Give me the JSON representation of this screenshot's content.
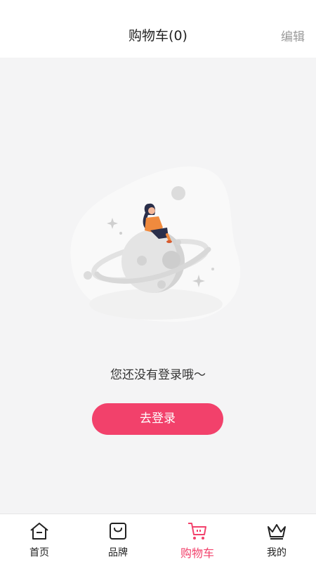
{
  "header": {
    "title": "购物车(0)",
    "edit_label": "编辑"
  },
  "empty_state": {
    "message": "您还没有登录哦～",
    "illustration_icon": "girl-on-planet-illustration"
  },
  "login_button": {
    "label": "去登录"
  },
  "tabbar": {
    "items": [
      {
        "label": "首页",
        "icon": "home-icon"
      },
      {
        "label": "品牌",
        "icon": "brand-bag-icon"
      },
      {
        "label": "购物车",
        "icon": "cart-icon"
      },
      {
        "label": "我的",
        "icon": "crown-icon"
      }
    ],
    "active_index": 2
  },
  "colors": {
    "accent": "#f2416b",
    "background": "#f4f4f5",
    "text": "#222222",
    "muted": "#9a9a9a"
  }
}
